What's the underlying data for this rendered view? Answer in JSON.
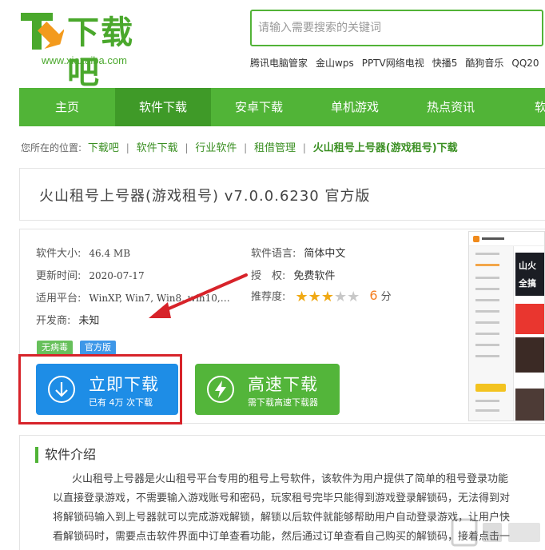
{
  "header": {
    "logo_title": "下载吧",
    "logo_url": "www.xiazaiba.com",
    "search_placeholder": "请输入需要搜索的关键词",
    "hot_links": [
      "腾讯电脑管家",
      "金山wps",
      "PPTV网络电视",
      "快播5",
      "酷狗音乐",
      "QQ20"
    ]
  },
  "nav": {
    "items": [
      "主页",
      "软件下载",
      "安卓下载",
      "单机游戏",
      "热点资讯",
      "软件"
    ],
    "active_index": 1
  },
  "breadcrumb": {
    "prefix": "您所在的位置:",
    "links": [
      "下载吧",
      "软件下载",
      "行业软件",
      "租借管理"
    ],
    "separator": "|",
    "current": "火山租号上号器(游戏租号)下载"
  },
  "software": {
    "title": "火山租号上号器(游戏租号) v7.0.0.6230 官方版",
    "size_label": "软件大小:",
    "size_value": "46.4 MB",
    "language_label": "软件语言:",
    "language_value": "简体中文",
    "updated_label": "更新时间:",
    "updated_value": "2020-07-17",
    "license_label": "授　权:",
    "license_value": "免费软件",
    "platform_label": "适用平台:",
    "platform_value": "WinXP, Win7, Win8, win10,…",
    "rating_label": "推荐度:",
    "rating_stars": 3,
    "rating_max": 5,
    "rating_score": "6",
    "rating_unit": "分",
    "developer_label": "开发商:",
    "developer_value": "未知",
    "tags": [
      "无病毒",
      "官方版"
    ]
  },
  "download_button": {
    "label": "立即下载",
    "sub_label": "已有 4万 次下载"
  },
  "fast_button": {
    "label": "高速下载",
    "sub_label": "需下载高速下载器"
  },
  "thumbnail": {
    "banner_text_1": "山火",
    "banner_text_2": "全搞"
  },
  "intro": {
    "heading": "软件介绍",
    "lines": [
      "火山租号上号器是火山租号平台专用的租号上号软件，该软件为用户提供了简单的租号登录功能",
      "以直接登录游戏，不需要输入游戏账号和密码，玩家租号完毕只能得到游戏登录解锁码，无法得到对",
      "将解锁码输入到上号器就可以完成游戏解锁，解锁以后软件就能够帮助用户自动登录游戏，让用户快",
      "看解锁码时，需要点击软件界面中订单查看功能，然后通过订单查看自己购买的解锁码，接着点击一"
    ]
  },
  "colors": {
    "brand_green": "#51b437",
    "nav_active": "#3f9a28",
    "download_blue": "#1e8de6",
    "highlight_red": "#d7232a",
    "score_orange": "#f57e20"
  }
}
